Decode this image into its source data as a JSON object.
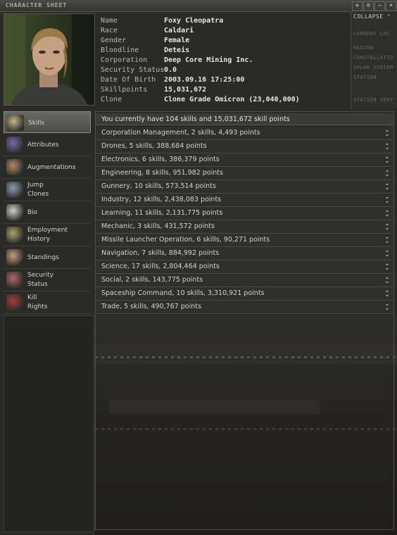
{
  "window": {
    "title": "CHARACTER SHEET"
  },
  "titlebar_buttons": [
    "pin-icon",
    "minimize-icon",
    "close-icon"
  ],
  "character": {
    "rows": [
      {
        "label": "Name",
        "value": "Foxy Cleopatra"
      },
      {
        "label": "Race",
        "value": "Caldari"
      },
      {
        "label": "Gender",
        "value": "Female"
      },
      {
        "label": "Bloodline",
        "value": "Deteis"
      },
      {
        "label": "Corporation",
        "value": "Deep Core Mining Inc."
      },
      {
        "label": "Security Status",
        "value": "0.0"
      },
      {
        "label": "Date Of Birth",
        "value": "2003.09.16 17:25:00"
      },
      {
        "label": "Skillpoints",
        "value": "15,031,672"
      },
      {
        "label": "Clone",
        "value": "Clone Grade Omicron (23,040,000)"
      }
    ]
  },
  "peek": {
    "collapse": "COLLAPSE",
    "lines": [
      "CURRENT LOC",
      "REGION",
      "CONSTELLATIO",
      "SOLAR SYSTEM",
      "STATION",
      "STATION SERV"
    ]
  },
  "sidebar": {
    "items": [
      {
        "l1": "Skills",
        "l2": "",
        "icon": "skills-icon",
        "active": true
      },
      {
        "l1": "Attributes",
        "l2": "",
        "icon": "attributes-icon"
      },
      {
        "l1": "Augmentations",
        "l2": "",
        "icon": "augmentations-icon"
      },
      {
        "l1": "Jump",
        "l2": "Clones",
        "icon": "jump-clones-icon"
      },
      {
        "l1": "Bio",
        "l2": "",
        "icon": "bio-icon"
      },
      {
        "l1": "Employment",
        "l2": "History",
        "icon": "employment-history-icon"
      },
      {
        "l1": "Standings",
        "l2": "",
        "icon": "standings-icon"
      },
      {
        "l1": "Security",
        "l2": "Status",
        "icon": "security-status-icon"
      },
      {
        "l1": "Kill",
        "l2": "Rights",
        "icon": "kill-rights-icon"
      }
    ]
  },
  "skills": {
    "summary": "You currently have 104 skills and 15,031,672 skill points",
    "groups": [
      "Corporation Management, 2 skills, 4,493 points",
      "Drones, 5 skills, 388,684 points",
      "Electronics, 6 skills, 386,379 points",
      "Engineering, 8 skills, 951,982 points",
      "Gunnery, 10 skills, 573,514 points",
      "Industry, 12 skills, 2,438,083 points",
      "Learning, 11 skills, 2,131,775 points",
      "Mechanic, 3 skills, 431,572 points",
      "Missile Launcher Operation, 6 skills, 90,271 points",
      "Navigation, 7 skills, 884,992 points",
      "Science, 17 skills, 2,804,464 points",
      "Social, 2 skills, 143,775 points",
      "Spaceship Command, 10 skills, 3,310,921 points",
      "Trade, 5 skills, 490,767 points"
    ]
  }
}
